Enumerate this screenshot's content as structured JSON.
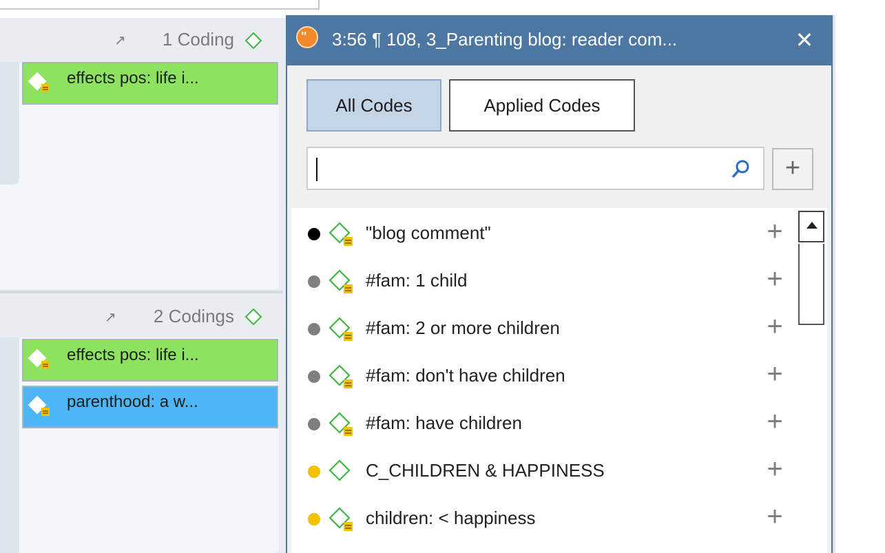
{
  "margin": {
    "segment1": {
      "count_label": "1 Coding",
      "codings": [
        {
          "label": "effects pos: life i...",
          "color": "#8de35f"
        }
      ]
    },
    "segment2": {
      "count_label": "2 Codings",
      "codings": [
        {
          "label": "effects pos: life i...",
          "color": "#8de35f"
        },
        {
          "label": "parenthood: a w...",
          "color": "#4db7f5"
        }
      ]
    },
    "ext_icon": "↗"
  },
  "popup": {
    "title": "3:56 ¶ 108, 3_Parenting blog: reader com...",
    "title_icon": "quotation-icon",
    "close_label": "✕",
    "tabs": {
      "all_codes": "All Codes",
      "applied_codes": "Applied Codes",
      "selected": "All Codes"
    },
    "search": {
      "value": "",
      "placeholder": ""
    },
    "add_label": "+",
    "codes": [
      {
        "label": "\"blog comment\"",
        "dot_color": "#000000",
        "has_comment": true
      },
      {
        "label": "#fam: 1 child",
        "dot_color": "#7f7f7f",
        "has_comment": true
      },
      {
        "label": "#fam: 2 or more  children",
        "dot_color": "#7f7f7f",
        "has_comment": true
      },
      {
        "label": "#fam: don't have children",
        "dot_color": "#7f7f7f",
        "has_comment": true
      },
      {
        "label": "#fam: have children",
        "dot_color": "#7f7f7f",
        "has_comment": true
      },
      {
        "label": "C_CHILDREN & HAPPINESS",
        "dot_color": "#f2c200",
        "has_comment": false
      },
      {
        "label": "children: < happiness",
        "dot_color": "#f2c200",
        "has_comment": true
      }
    ],
    "item_add_label": "+"
  },
  "colors": {
    "titlebar": "#4d77a3",
    "code_diamond": "#3fb53f",
    "comment_badge": "#f2c200"
  }
}
